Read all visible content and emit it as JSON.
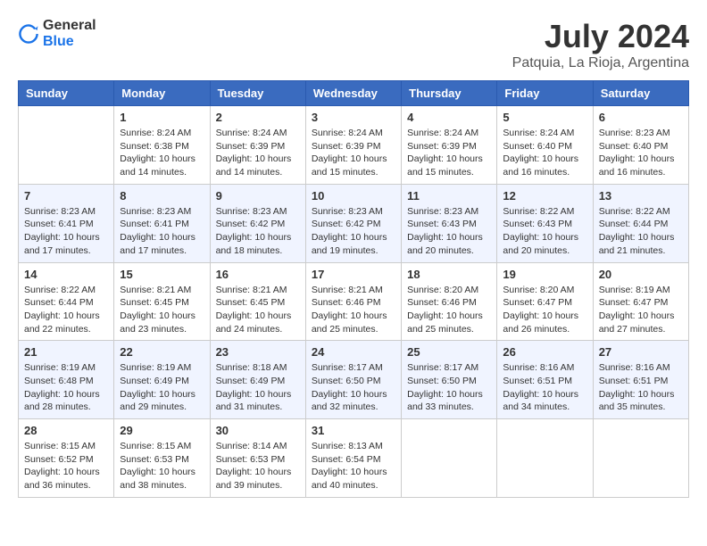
{
  "logo": {
    "general": "General",
    "blue": "Blue"
  },
  "title": "July 2024",
  "location": "Patquia, La Rioja, Argentina",
  "days_of_week": [
    "Sunday",
    "Monday",
    "Tuesday",
    "Wednesday",
    "Thursday",
    "Friday",
    "Saturday"
  ],
  "weeks": [
    [
      {
        "day": "",
        "info": ""
      },
      {
        "day": "1",
        "info": "Sunrise: 8:24 AM\nSunset: 6:38 PM\nDaylight: 10 hours\nand 14 minutes."
      },
      {
        "day": "2",
        "info": "Sunrise: 8:24 AM\nSunset: 6:39 PM\nDaylight: 10 hours\nand 14 minutes."
      },
      {
        "day": "3",
        "info": "Sunrise: 8:24 AM\nSunset: 6:39 PM\nDaylight: 10 hours\nand 15 minutes."
      },
      {
        "day": "4",
        "info": "Sunrise: 8:24 AM\nSunset: 6:39 PM\nDaylight: 10 hours\nand 15 minutes."
      },
      {
        "day": "5",
        "info": "Sunrise: 8:24 AM\nSunset: 6:40 PM\nDaylight: 10 hours\nand 16 minutes."
      },
      {
        "day": "6",
        "info": "Sunrise: 8:23 AM\nSunset: 6:40 PM\nDaylight: 10 hours\nand 16 minutes."
      }
    ],
    [
      {
        "day": "7",
        "info": "Sunrise: 8:23 AM\nSunset: 6:41 PM\nDaylight: 10 hours\nand 17 minutes."
      },
      {
        "day": "8",
        "info": "Sunrise: 8:23 AM\nSunset: 6:41 PM\nDaylight: 10 hours\nand 17 minutes."
      },
      {
        "day": "9",
        "info": "Sunrise: 8:23 AM\nSunset: 6:42 PM\nDaylight: 10 hours\nand 18 minutes."
      },
      {
        "day": "10",
        "info": "Sunrise: 8:23 AM\nSunset: 6:42 PM\nDaylight: 10 hours\nand 19 minutes."
      },
      {
        "day": "11",
        "info": "Sunrise: 8:23 AM\nSunset: 6:43 PM\nDaylight: 10 hours\nand 20 minutes."
      },
      {
        "day": "12",
        "info": "Sunrise: 8:22 AM\nSunset: 6:43 PM\nDaylight: 10 hours\nand 20 minutes."
      },
      {
        "day": "13",
        "info": "Sunrise: 8:22 AM\nSunset: 6:44 PM\nDaylight: 10 hours\nand 21 minutes."
      }
    ],
    [
      {
        "day": "14",
        "info": "Sunrise: 8:22 AM\nSunset: 6:44 PM\nDaylight: 10 hours\nand 22 minutes."
      },
      {
        "day": "15",
        "info": "Sunrise: 8:21 AM\nSunset: 6:45 PM\nDaylight: 10 hours\nand 23 minutes."
      },
      {
        "day": "16",
        "info": "Sunrise: 8:21 AM\nSunset: 6:45 PM\nDaylight: 10 hours\nand 24 minutes."
      },
      {
        "day": "17",
        "info": "Sunrise: 8:21 AM\nSunset: 6:46 PM\nDaylight: 10 hours\nand 25 minutes."
      },
      {
        "day": "18",
        "info": "Sunrise: 8:20 AM\nSunset: 6:46 PM\nDaylight: 10 hours\nand 25 minutes."
      },
      {
        "day": "19",
        "info": "Sunrise: 8:20 AM\nSunset: 6:47 PM\nDaylight: 10 hours\nand 26 minutes."
      },
      {
        "day": "20",
        "info": "Sunrise: 8:19 AM\nSunset: 6:47 PM\nDaylight: 10 hours\nand 27 minutes."
      }
    ],
    [
      {
        "day": "21",
        "info": "Sunrise: 8:19 AM\nSunset: 6:48 PM\nDaylight: 10 hours\nand 28 minutes."
      },
      {
        "day": "22",
        "info": "Sunrise: 8:19 AM\nSunset: 6:49 PM\nDaylight: 10 hours\nand 29 minutes."
      },
      {
        "day": "23",
        "info": "Sunrise: 8:18 AM\nSunset: 6:49 PM\nDaylight: 10 hours\nand 31 minutes."
      },
      {
        "day": "24",
        "info": "Sunrise: 8:17 AM\nSunset: 6:50 PM\nDaylight: 10 hours\nand 32 minutes."
      },
      {
        "day": "25",
        "info": "Sunrise: 8:17 AM\nSunset: 6:50 PM\nDaylight: 10 hours\nand 33 minutes."
      },
      {
        "day": "26",
        "info": "Sunrise: 8:16 AM\nSunset: 6:51 PM\nDaylight: 10 hours\nand 34 minutes."
      },
      {
        "day": "27",
        "info": "Sunrise: 8:16 AM\nSunset: 6:51 PM\nDaylight: 10 hours\nand 35 minutes."
      }
    ],
    [
      {
        "day": "28",
        "info": "Sunrise: 8:15 AM\nSunset: 6:52 PM\nDaylight: 10 hours\nand 36 minutes."
      },
      {
        "day": "29",
        "info": "Sunrise: 8:15 AM\nSunset: 6:53 PM\nDaylight: 10 hours\nand 38 minutes."
      },
      {
        "day": "30",
        "info": "Sunrise: 8:14 AM\nSunset: 6:53 PM\nDaylight: 10 hours\nand 39 minutes."
      },
      {
        "day": "31",
        "info": "Sunrise: 8:13 AM\nSunset: 6:54 PM\nDaylight: 10 hours\nand 40 minutes."
      },
      {
        "day": "",
        "info": ""
      },
      {
        "day": "",
        "info": ""
      },
      {
        "day": "",
        "info": ""
      }
    ]
  ]
}
